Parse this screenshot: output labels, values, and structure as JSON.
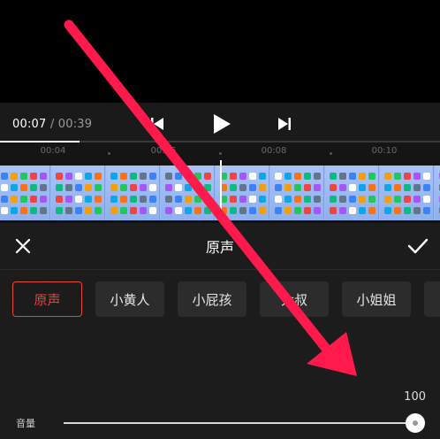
{
  "player": {
    "current_time": "00:07",
    "separator": "/",
    "duration": "00:39",
    "progress_fraction": 0.18,
    "icons": [
      "skip-back-icon",
      "play-icon",
      "skip-forward-icon"
    ]
  },
  "timeline": {
    "ticks": [
      "00:04",
      "00:06",
      "00:08",
      "00:10"
    ]
  },
  "panel": {
    "title": "原声",
    "close_icon": "close-icon",
    "confirm_icon": "checkmark-icon"
  },
  "voices": [
    {
      "label": "原声",
      "selected": true
    },
    {
      "label": "小黄人",
      "selected": false
    },
    {
      "label": "小屁孩",
      "selected": false
    },
    {
      "label": "大叔",
      "selected": false
    },
    {
      "label": "小姐姐",
      "selected": false
    },
    {
      "label": "",
      "selected": false
    }
  ],
  "volume": {
    "label": "音量",
    "value": "100",
    "fraction": 1.0
  },
  "colors": {
    "accent": "#f0413a",
    "annotation_arrow": "#ff1a4b"
  }
}
